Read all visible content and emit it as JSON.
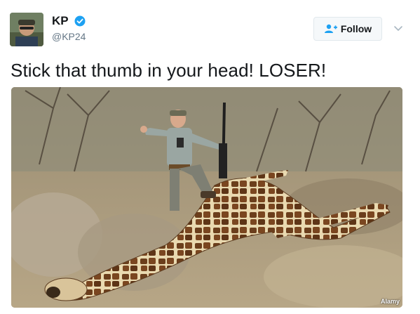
{
  "author": {
    "display_name": "KP",
    "handle": "@KP24",
    "verified": true
  },
  "actions": {
    "follow_label": "Follow"
  },
  "tweet": {
    "text": "Stick that thumb in your head! LOSER!"
  },
  "media": {
    "watermark": "Alamy"
  },
  "colors": {
    "brand_blue": "#1da1f2",
    "text_primary": "#14171a",
    "text_secondary": "#657786"
  },
  "icons": [
    "verified-badge-icon",
    "follow-person-plus-icon",
    "chevron-down-icon"
  ]
}
